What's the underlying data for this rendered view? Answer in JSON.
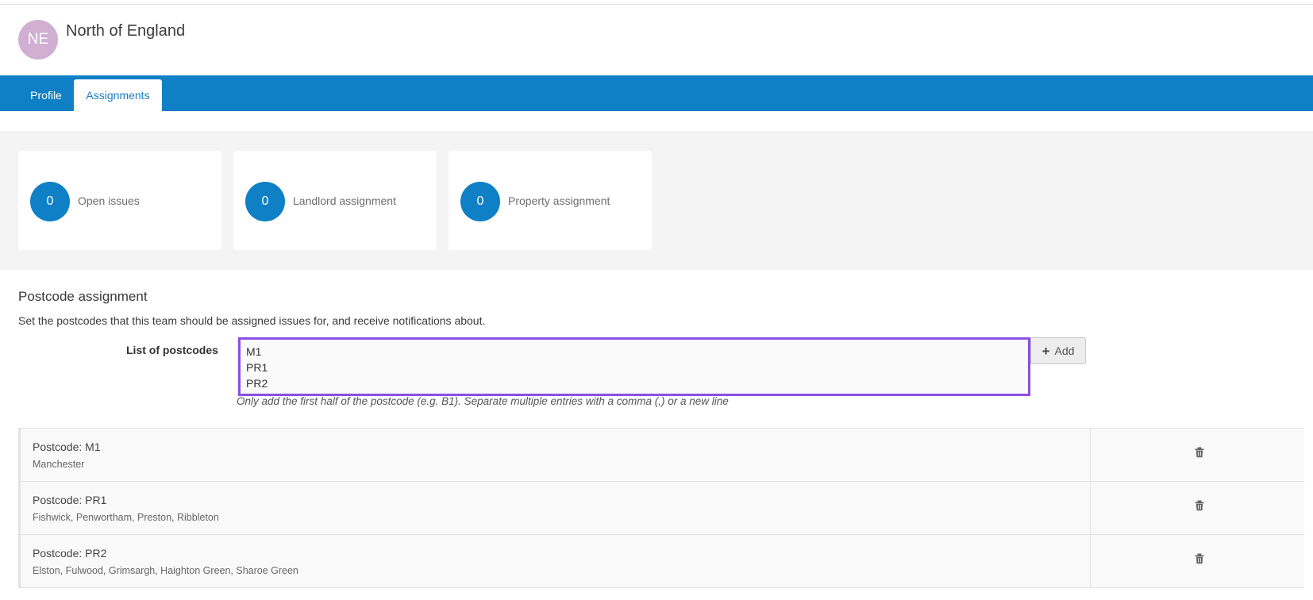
{
  "team": {
    "initials": "NE",
    "name": "North of England",
    "avatar_color": "#d0afd2"
  },
  "tabs": [
    {
      "label": "Profile",
      "active": false
    },
    {
      "label": "Assignments",
      "active": true
    }
  ],
  "theme": {
    "brand": "#0f80c6",
    "focus_border": "#8c4fe3"
  },
  "stats": [
    {
      "value": "0",
      "label": "Open issues"
    },
    {
      "value": "0",
      "label": "Landlord assignment"
    },
    {
      "value": "0",
      "label": "Property assignment"
    }
  ],
  "postcode_section": {
    "title": "Postcode assignment",
    "description": "Set the postcodes that this team should be assigned issues for, and receive notifications about.",
    "field_label": "List of postcodes",
    "field_value": "M1\nPR1\nPR2",
    "add_icon": "plus-icon",
    "add_label": "Add",
    "help_text": "Only add the first half of the postcode (e.g. B1). Separate multiple entries with a comma (,) or a new line"
  },
  "postcodes": [
    {
      "title": "Postcode: M1",
      "areas": "Manchester",
      "delete_icon": "trash-icon"
    },
    {
      "title": "Postcode: PR1",
      "areas": "Fishwick, Penwortham, Preston, Ribbleton",
      "delete_icon": "trash-icon"
    },
    {
      "title": "Postcode: PR2",
      "areas": "Elston, Fulwood, Grimsargh, Haighton Green, Sharoe Green",
      "delete_icon": "trash-icon"
    }
  ]
}
